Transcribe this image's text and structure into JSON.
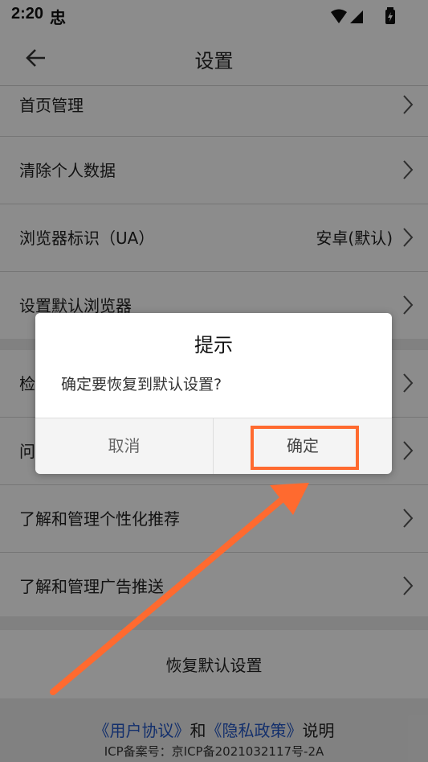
{
  "status": {
    "time": "2:20",
    "extra": "忠"
  },
  "appbar": {
    "title": "设置"
  },
  "settings": [
    {
      "label": "首页管理",
      "value": ""
    },
    {
      "label": "清除个人数据",
      "value": ""
    },
    {
      "label": "浏览器标识（UA）",
      "value": "安卓(默认)"
    },
    {
      "label": "设置默认浏览器",
      "value": ""
    },
    {
      "label": "检",
      "value": ""
    },
    {
      "label": "问",
      "value": ""
    },
    {
      "label": "了解和管理个性化推荐",
      "value": ""
    },
    {
      "label": "了解和管理广告推送",
      "value": ""
    }
  ],
  "restore": {
    "label": "恢复默认设置"
  },
  "footer": {
    "user_agreement": "《用户协议》",
    "and": "和",
    "privacy_policy": "《隐私政策》",
    "explain": "说明",
    "icp": "ICP备案号：京ICP备2021032117号-2A"
  },
  "dialog": {
    "title": "提示",
    "message": "确定要恢复到默认设置?",
    "cancel": "取消",
    "confirm": "确定"
  },
  "colors": {
    "highlight": "#ff6a2f",
    "link": "#2457c5"
  }
}
